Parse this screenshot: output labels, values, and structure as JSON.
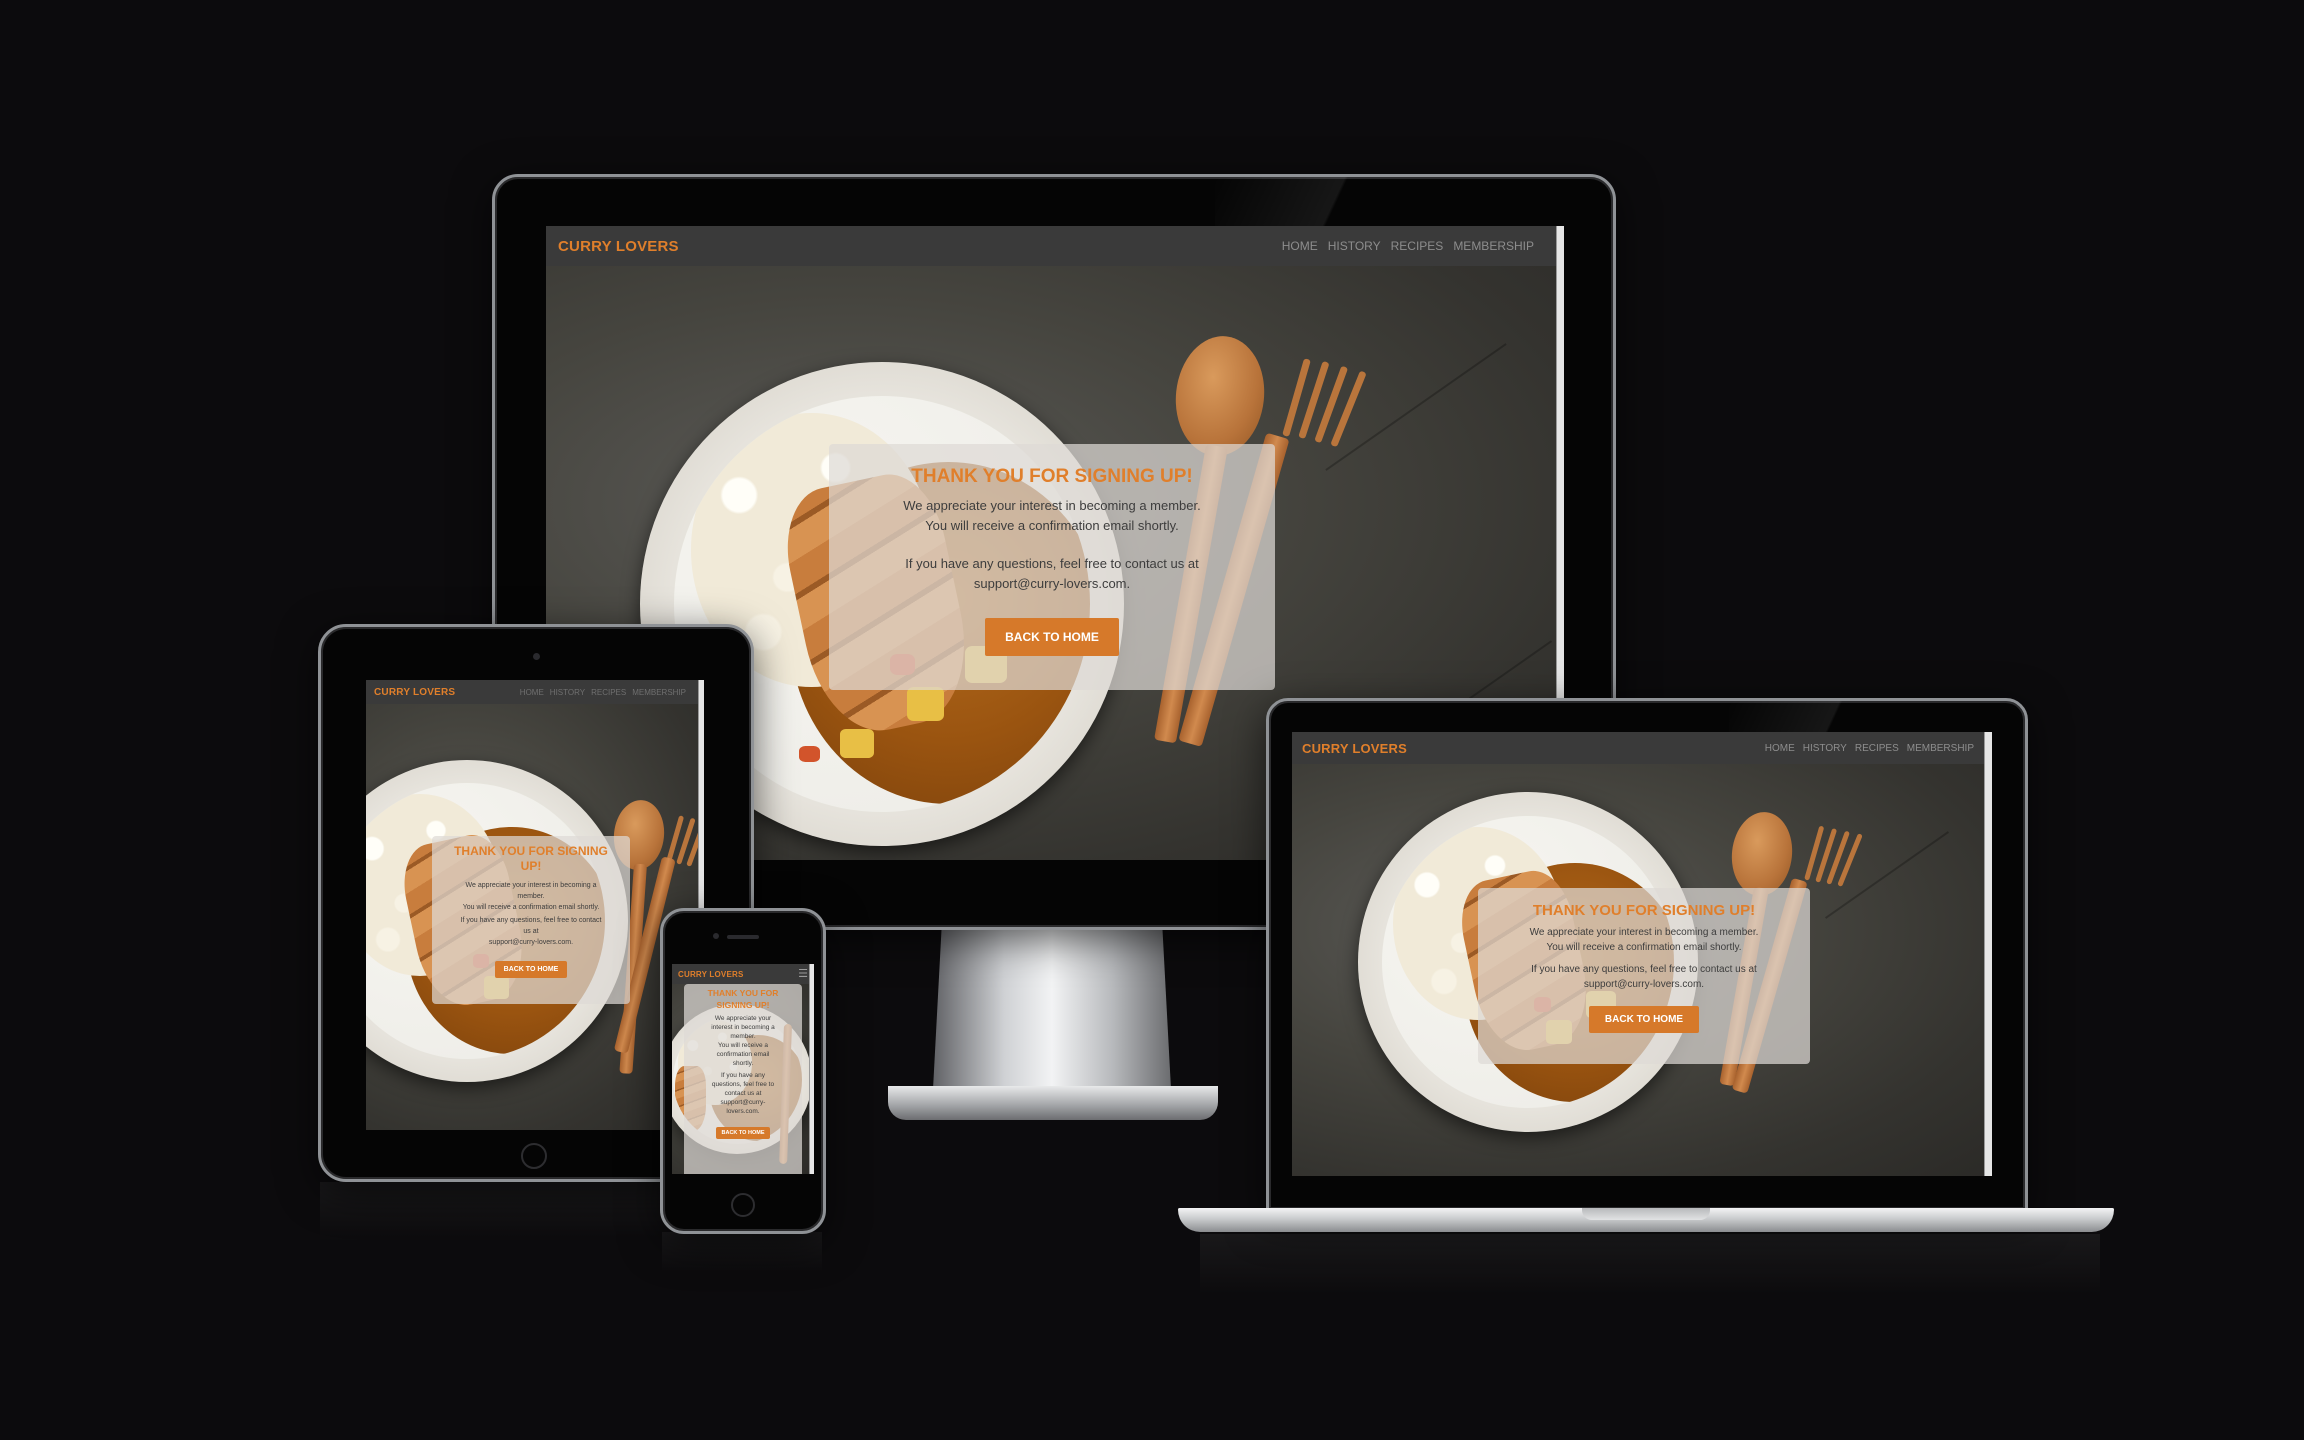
{
  "brand": "CURRY LOVERS",
  "nav": {
    "home": "HOME",
    "history": "HISTORY",
    "recipes": "RECIPES",
    "membership": "MEMBERSHIP"
  },
  "card": {
    "title": "THANK YOU FOR SIGNING UP!",
    "line1": "We appreciate your interest in becoming a member.",
    "line2": "You will receive a confirmation email shortly.",
    "line3": "If you have any questions, feel free to contact us at",
    "email": "support@curry-lovers.com.",
    "button": "BACK TO HOME"
  },
  "tablet_card": {
    "title_a": "THANK YOU FOR SIGNING",
    "title_b": "UP!",
    "line1a": "We appreciate your interest in becoming a",
    "line1b": "member.",
    "line2": "You will receive a confirmation email shortly.",
    "line3a": "If you have any questions, feel free to contact",
    "line3b": "us at",
    "email": "support@curry-lovers.com."
  },
  "phone_card": {
    "title_a": "THANK YOU FOR",
    "title_b": "SIGNING UP!",
    "l1": "We appreciate your",
    "l2": "interest in becoming a",
    "l3": "member.",
    "l4": "You will receive a",
    "l5": "confirmation email",
    "l6": "shortly.",
    "l7": "If you have any",
    "l8": "questions, feel free to",
    "l9": "contact us at",
    "l10": "support@curry-",
    "l11": "lovers.com."
  },
  "colors": {
    "accent": "#e07f2b",
    "button": "#d6792a",
    "navbar": "#3a3a3a",
    "background": "#0c0b0d"
  },
  "icons": {
    "menu": "hamburger-menu-icon"
  }
}
